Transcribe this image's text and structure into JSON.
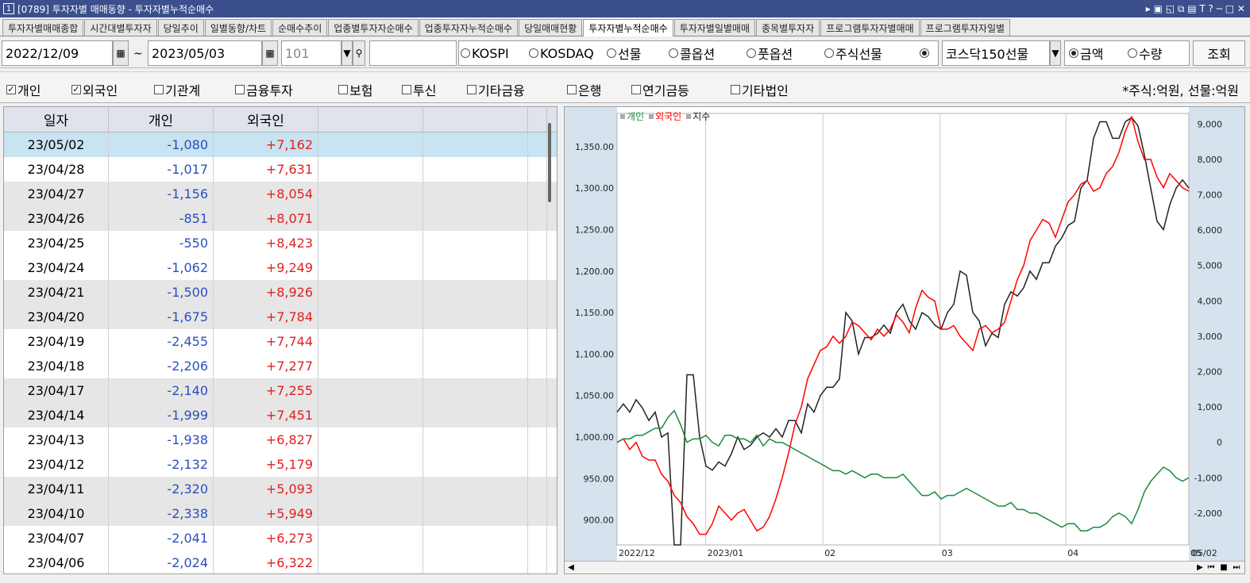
{
  "titlebar": {
    "number": "1",
    "title": "[0789] 투자자별 매매동향 - 투자자별누적순매수",
    "controls": "▸ ▣ ◱ ⧉ ▤ T ? ─ □ ✕"
  },
  "tabs": [
    "투자자별매매종합",
    "시간대별투자자",
    "당일추이",
    "일별동향/차트",
    "순매수추이",
    "업종별투자자순매수",
    "업종투자자누적순매수",
    "당일매매현황",
    "투자자별누적순매수",
    "투자자별일별매매",
    "종목별투자자",
    "프로그램투자자별매매",
    "프로그램투자자일별"
  ],
  "active_tab": 8,
  "toolbar": {
    "start_date": "2022/12/09",
    "tilde": "~",
    "end_date": "2023/05/03",
    "code": "101",
    "market_radios": [
      {
        "label": "KOSPI",
        "checked": false
      },
      {
        "label": "KOSDAQ",
        "checked": false
      },
      {
        "label": "선물",
        "checked": false
      },
      {
        "label": "콜옵션",
        "checked": false
      },
      {
        "label": "풋옵션",
        "checked": false
      },
      {
        "label": "주식선물",
        "checked": false
      },
      {
        "label": "",
        "checked": true
      }
    ],
    "product": "코스닥150선물",
    "value_radios": [
      {
        "label": "금액",
        "checked": true
      },
      {
        "label": "수량",
        "checked": false
      }
    ],
    "search_label": "조회"
  },
  "investors": [
    {
      "label": "개인",
      "checked": true
    },
    {
      "label": "외국인",
      "checked": true
    },
    {
      "label": "기관계",
      "checked": false
    },
    {
      "label": "금융투자",
      "checked": false
    },
    {
      "label": "보험",
      "checked": false
    },
    {
      "label": "투신",
      "checked": false
    },
    {
      "label": "기타금융",
      "checked": false
    },
    {
      "label": "은행",
      "checked": false
    },
    {
      "label": "연기금등",
      "checked": false
    },
    {
      "label": "기타법인",
      "checked": false
    }
  ],
  "unit_note": "*주식:억원, 선물:억원",
  "table": {
    "headers": [
      "일자",
      "개인",
      "외국인",
      "",
      ""
    ],
    "rows": [
      [
        "23/05/02",
        "-1,080",
        "+7,162"
      ],
      [
        "23/04/28",
        "-1,017",
        "+7,631"
      ],
      [
        "23/04/27",
        "-1,156",
        "+8,054"
      ],
      [
        "23/04/26",
        "-851",
        "+8,071"
      ],
      [
        "23/04/25",
        "-550",
        "+8,423"
      ],
      [
        "23/04/24",
        "-1,062",
        "+9,249"
      ],
      [
        "23/04/21",
        "-1,500",
        "+8,926"
      ],
      [
        "23/04/20",
        "-1,675",
        "+7,784"
      ],
      [
        "23/04/19",
        "-2,455",
        "+7,744"
      ],
      [
        "23/04/18",
        "-2,206",
        "+7,277"
      ],
      [
        "23/04/17",
        "-2,140",
        "+7,255"
      ],
      [
        "23/04/14",
        "-1,999",
        "+7,451"
      ],
      [
        "23/04/13",
        "-1,938",
        "+6,827"
      ],
      [
        "23/04/12",
        "-2,132",
        "+5,179"
      ],
      [
        "23/04/11",
        "-2,320",
        "+5,093"
      ],
      [
        "23/04/10",
        "-2,338",
        "+5,949"
      ],
      [
        "23/04/07",
        "-2,041",
        "+6,273"
      ],
      [
        "23/04/06",
        "-2,024",
        "+6,322"
      ]
    ]
  },
  "chart_data": {
    "type": "line",
    "legend": [
      "개인",
      "외국인",
      "지수"
    ],
    "colors": {
      "개인": "#1a8a3a",
      "외국인": "#ff0000",
      "지수": "#222222"
    },
    "left_axis": {
      "ticks": [
        "1,350.00",
        "1,300.00",
        "1,250.00",
        "1,200.00",
        "1,150.00",
        "1,100.00",
        "1,050.00",
        "1,000.00",
        "950.00",
        "900.00"
      ],
      "values": [
        1350,
        1300,
        1250,
        1200,
        1150,
        1100,
        1050,
        1000,
        950,
        900
      ],
      "range": [
        870,
        1390
      ]
    },
    "right_axis": {
      "ticks": [
        "9,000",
        "8,000",
        "7,000",
        "6,000",
        "5,000",
        "4,000",
        "3,000",
        "2,000",
        "1,000",
        "0",
        "-1,000",
        "-2,000"
      ],
      "values": [
        9000,
        8000,
        7000,
        6000,
        5000,
        4000,
        3000,
        2000,
        1000,
        0,
        -1000,
        -2000
      ],
      "range": [
        -2900,
        9300
      ]
    },
    "x_labels": [
      "2022/12",
      "2023/01",
      "02",
      "03",
      "04",
      "05",
      "05/02"
    ],
    "series": [
      {
        "name": "지수",
        "values": [
          1030,
          1040,
          1030,
          1045,
          1035,
          1020,
          1030,
          1000,
          1005,
          870,
          870,
          1075,
          1075,
          1000,
          965,
          960,
          970,
          965,
          980,
          1000,
          985,
          990,
          1000,
          1005,
          1000,
          1010,
          1000,
          1020,
          1020,
          1005,
          1040,
          1030,
          1050,
          1060,
          1060,
          1070,
          1150,
          1140,
          1100,
          1120,
          1120,
          1125,
          1135,
          1125,
          1150,
          1160,
          1140,
          1130,
          1150,
          1145,
          1135,
          1130,
          1150,
          1160,
          1200,
          1195,
          1150,
          1140,
          1110,
          1125,
          1120,
          1160,
          1175,
          1170,
          1180,
          1200,
          1190,
          1210,
          1210,
          1230,
          1240,
          1255,
          1260,
          1300,
          1310,
          1360,
          1380,
          1380,
          1360,
          1360,
          1380,
          1385,
          1375,
          1340,
          1300,
          1260,
          1250,
          1280,
          1300,
          1310,
          1300
        ]
      },
      {
        "name": "외국인",
        "values": [
          0,
          0.1,
          -0.2,
          0,
          -0.4,
          -0.5,
          -0.5,
          -0.9,
          -1.1,
          -1.5,
          -1.7,
          -2.1,
          -2.3,
          -2.6,
          -2.6,
          -2.3,
          -1.8,
          -2.0,
          -2.2,
          -2.0,
          -1.9,
          -2.2,
          -2.5,
          -2.4,
          -2.1,
          -1.6,
          -1.0,
          -0.3,
          0.5,
          1.0,
          1.8,
          2.2,
          2.6,
          2.7,
          3.0,
          2.8,
          3.0,
          3.4,
          3.3,
          3.1,
          2.9,
          3.2,
          3.0,
          3.2,
          3.6,
          3.4,
          3.1,
          3.8,
          4.3,
          4.1,
          4.0,
          3.2,
          3.2,
          3.3,
          3.0,
          2.8,
          2.6,
          3.2,
          3.3,
          3.1,
          3.2,
          3.4,
          4.0,
          4.6,
          5.0,
          5.7,
          6.0,
          6.3,
          6.2,
          5.8,
          6.3,
          6.8,
          7.0,
          7.3,
          7.4,
          7.1,
          7.2,
          7.6,
          7.8,
          8.2,
          8.8,
          9.2,
          8.5,
          8.0,
          8.0,
          7.5,
          7.2,
          7.6,
          7.4,
          7.2,
          7.1
        ]
      },
      {
        "name": "개인",
        "values": [
          0,
          0.1,
          0.1,
          0.2,
          0.2,
          0.3,
          0.4,
          0.4,
          0.7,
          0.9,
          0.5,
          0,
          0.1,
          0.1,
          0.2,
          0,
          -0.1,
          0.2,
          0.2,
          0.1,
          0.1,
          0.0,
          0.2,
          -0.1,
          0.1,
          0.0,
          0.0,
          -0.1,
          -0.2,
          -0.3,
          -0.4,
          -0.5,
          -0.6,
          -0.7,
          -0.8,
          -0.8,
          -0.9,
          -0.8,
          -0.9,
          -1.0,
          -0.9,
          -0.9,
          -1.0,
          -1.0,
          -1.0,
          -0.9,
          -1.1,
          -1.3,
          -1.5,
          -1.5,
          -1.4,
          -1.6,
          -1.5,
          -1.5,
          -1.4,
          -1.3,
          -1.4,
          -1.5,
          -1.6,
          -1.7,
          -1.8,
          -1.8,
          -1.7,
          -1.9,
          -1.9,
          -2.0,
          -2.0,
          -2.1,
          -2.2,
          -2.3,
          -2.4,
          -2.3,
          -2.3,
          -2.5,
          -2.5,
          -2.4,
          -2.4,
          -2.3,
          -2.1,
          -2.0,
          -2.1,
          -2.3,
          -1.9,
          -1.4,
          -1.1,
          -0.9,
          -0.7,
          -0.8,
          -1.0,
          -1.1,
          -1.0
        ]
      }
    ]
  }
}
